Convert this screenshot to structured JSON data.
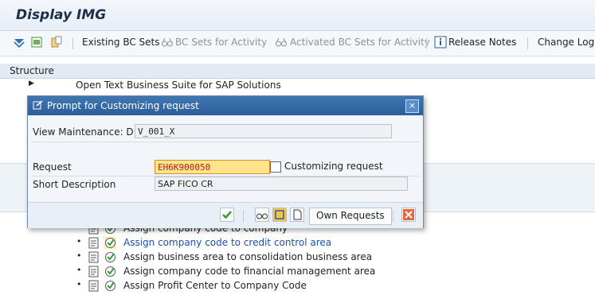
{
  "app": {
    "title": "Display IMG"
  },
  "toolbar": {
    "existing_bc_sets": "Existing BC Sets",
    "bc_sets_activity": "BC Sets for Activity",
    "activated_bc_sets": "Activated BC Sets for Activity",
    "release_notes": "Release Notes",
    "change_log": "Change Log"
  },
  "structure": {
    "header": "Structure"
  },
  "tree": {
    "top_item": "Open Text Business Suite for SAP Solutions",
    "items": [
      "Assign company code to company",
      "Assign company code to credit control area",
      "Assign business area to consolidation business area",
      "Assign company code to financial management area",
      "Assign Profit Center to Company Code"
    ]
  },
  "dialog": {
    "title": "Prompt for Customizing request",
    "view_label": "View Maintenance: D...",
    "view_value": "V_001_X",
    "request_label": "Request",
    "request_value": "EH6K900050",
    "request_suffix": "Customizing request",
    "short_desc_label": "Short Description",
    "short_desc_value": "SAP FICO CR",
    "own_requests": "Own Requests",
    "close": "×"
  }
}
